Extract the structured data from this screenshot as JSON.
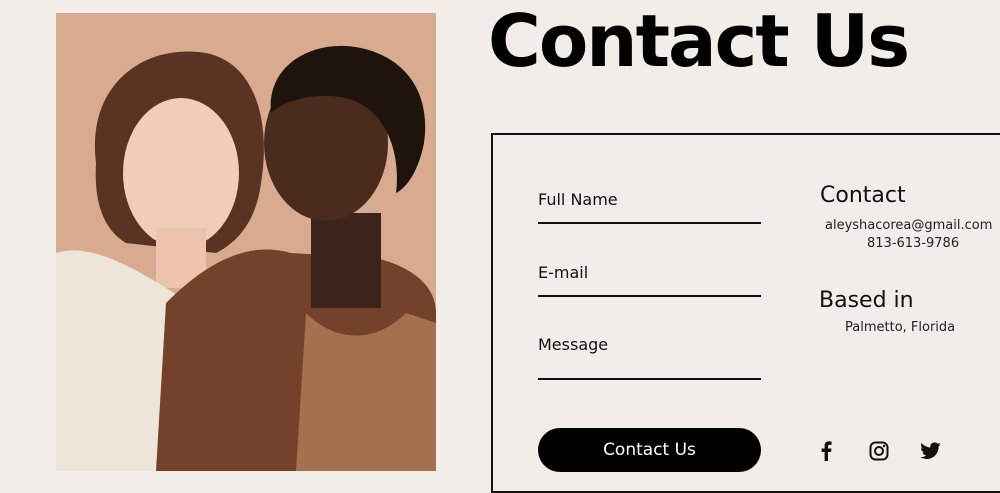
{
  "header": {
    "title": "Contact Us"
  },
  "form": {
    "full_name_label": "Full Name",
    "email_label": "E-mail",
    "message_label": "Message",
    "submit_label": "Contact Us"
  },
  "contact": {
    "heading": "Contact",
    "email": "aleyshacorea@gmail.com",
    "phone": "813-613-9786"
  },
  "location": {
    "heading": "Based in",
    "city": "Palmetto, Florida"
  },
  "social": [
    {
      "icon": "facebook-icon"
    },
    {
      "icon": "instagram-icon"
    },
    {
      "icon": "twitter-icon"
    }
  ],
  "colors": {
    "background": "#f2ede8",
    "photo_background": "#d9ad94",
    "button": "#000000",
    "text": "#111111"
  }
}
